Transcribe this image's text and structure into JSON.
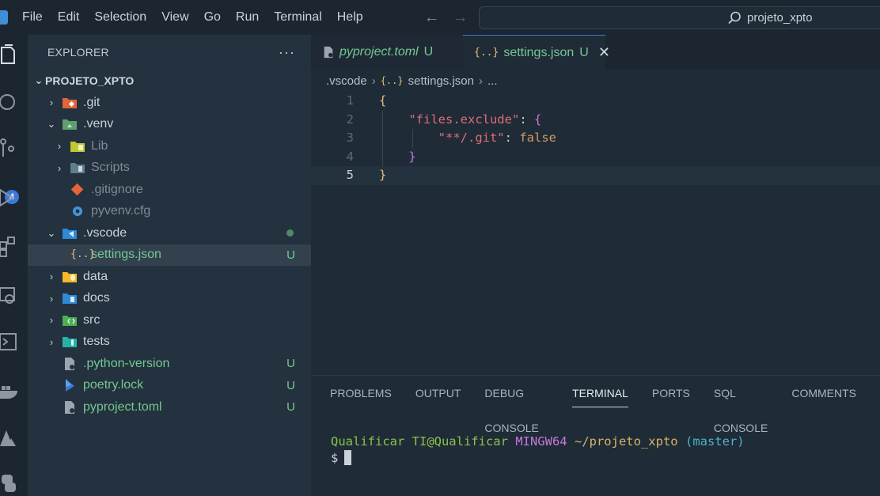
{
  "titlebar": {
    "menu": [
      "File",
      "Edit",
      "Selection",
      "View",
      "Go",
      "Run",
      "Terminal",
      "Help"
    ],
    "search_text": "projeto_xpto"
  },
  "activity": {
    "scm_badge": "4"
  },
  "sidebar": {
    "title": "EXPLORER",
    "more": "···",
    "root": "PROJETO_XPTO",
    "items": [
      {
        "label": ".git",
        "status": ""
      },
      {
        "label": ".venv",
        "status": ""
      },
      {
        "label": "Lib",
        "status": ""
      },
      {
        "label": "Scripts",
        "status": ""
      },
      {
        "label": ".gitignore",
        "status": ""
      },
      {
        "label": "pyvenv.cfg",
        "status": ""
      },
      {
        "label": ".vscode",
        "status": ""
      },
      {
        "label": "settings.json",
        "status": "U"
      },
      {
        "label": "data",
        "status": ""
      },
      {
        "label": "docs",
        "status": ""
      },
      {
        "label": "src",
        "status": ""
      },
      {
        "label": "tests",
        "status": ""
      },
      {
        "label": ".python-version",
        "status": "U"
      },
      {
        "label": "poetry.lock",
        "status": "U"
      },
      {
        "label": "pyproject.toml",
        "status": "U"
      }
    ]
  },
  "editor": {
    "tabs": [
      {
        "name": "pyproject.toml",
        "status": "U"
      },
      {
        "name": "settings.json",
        "status": "U",
        "close": "✕"
      }
    ],
    "breadcrumb": {
      "folder": ".vscode",
      "file": "settings.json",
      "more": "..."
    },
    "lines": [
      {
        "num": "1",
        "open": "{"
      },
      {
        "num": "2",
        "key": "\"files.exclude\"",
        "colon": ": ",
        "open": "{"
      },
      {
        "num": "3",
        "key": "\"**/.git\"",
        "colon": ": ",
        "value": "false"
      },
      {
        "num": "4",
        "close": "}"
      },
      {
        "num": "5",
        "close": "}"
      }
    ]
  },
  "panel": {
    "tabs": [
      "PROBLEMS",
      "OUTPUT",
      "DEBUG CONSOLE",
      "TERMINAL",
      "PORTS",
      "SQL CONSOLE",
      "COMMENTS"
    ],
    "active_tab": "TERMINAL",
    "terminal": {
      "host": "Qualificar TI@Qualificar",
      "shell": "MINGW64",
      "path": "~/projeto_xpto",
      "branch": "(master)",
      "prompt": "$"
    }
  },
  "colors": {
    "untracked": "#73c991",
    "accent": "#3b78d8"
  }
}
